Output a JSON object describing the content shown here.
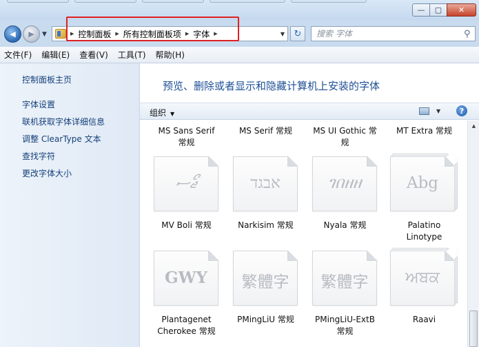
{
  "window": {
    "controls": {
      "minimize": "—",
      "maximize": "▢",
      "close": "✕"
    }
  },
  "nav": {
    "back_icon": "◀",
    "forward_icon": "▶",
    "history_icon": "▼",
    "breadcrumb": [
      "控制面板",
      "所有控制面板项",
      "字体"
    ],
    "refresh_icon": "↻",
    "search_placeholder": "搜索 字体"
  },
  "menu": [
    "文件(F)",
    "编辑(E)",
    "查看(V)",
    "工具(T)",
    "帮助(H)"
  ],
  "sidebar": {
    "home": "控制面板主页",
    "links": [
      "字体设置",
      "联机获取字体详细信息",
      "调整 ClearType 文本",
      "查找字符",
      "更改字体大小"
    ]
  },
  "main": {
    "title": "预览、删除或者显示和隐藏计算机上安装的字体",
    "organize_label": "组织",
    "help_icon": "?"
  },
  "fonts_top_row": [
    {
      "name": "MS Sans Serif",
      "style": "常规"
    },
    {
      "name": "MS Serif 常规"
    },
    {
      "name": "MS UI Gothic 常",
      "style": "规"
    },
    {
      "name": "MT Extra 常规"
    }
  ],
  "fonts_row2": [
    {
      "sample": "ޖޯސ",
      "name": "MV Boli 常规",
      "name2": ""
    },
    {
      "sample": "אבגד",
      "name": "Narkisim 常规",
      "name2": ""
    },
    {
      "sample": "ገበዘዘ",
      "name": "Nyala 常规",
      "name2": ""
    },
    {
      "sample": "Abg",
      "name": "Palatino",
      "name2": "Linotype"
    }
  ],
  "fonts_row3": [
    {
      "sample": "GWY",
      "name": "Plantagenet",
      "name2": "Cherokee 常规"
    },
    {
      "sample": "繁體字",
      "name": "PMingLiU 常规",
      "name2": ""
    },
    {
      "sample": "繁體字",
      "name": "PMingLiU-ExtB",
      "name2": "常规"
    },
    {
      "sample": "ਅਬਕ",
      "name": "Raavi",
      "name2": ""
    }
  ]
}
